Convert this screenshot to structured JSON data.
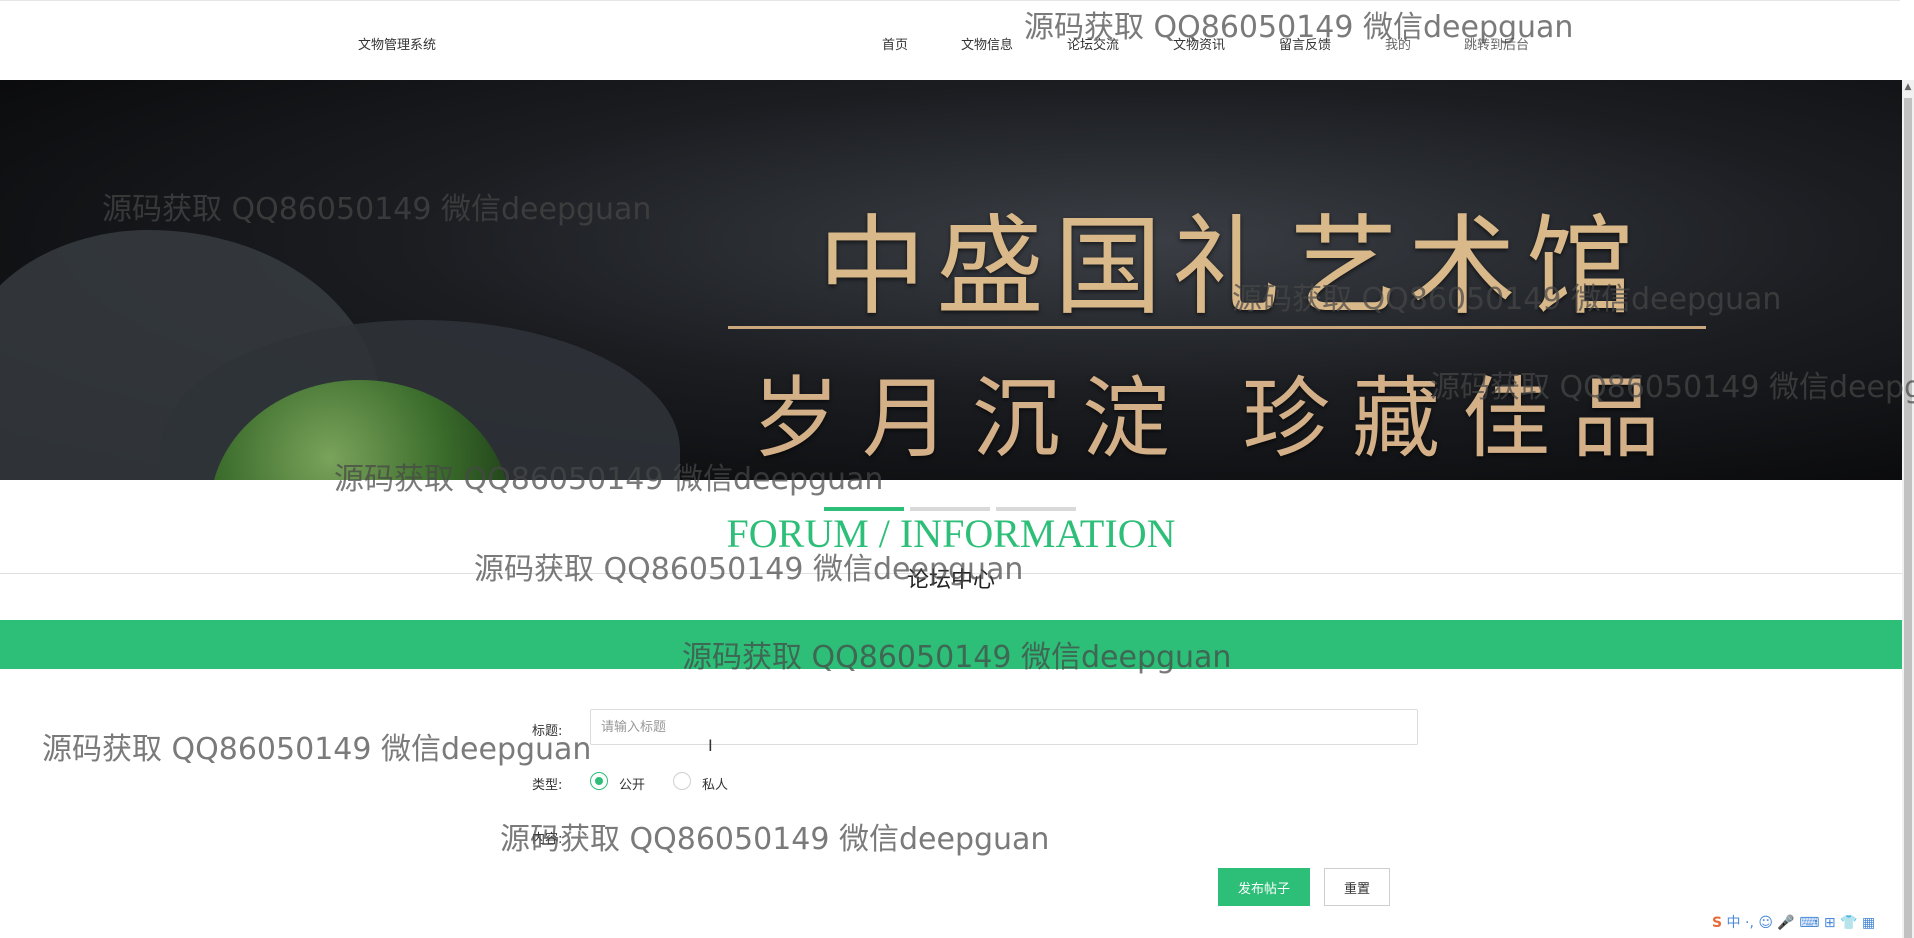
{
  "header": {
    "logo": "文物管理系统",
    "nav": [
      "首页",
      "文物信息",
      "论坛交流",
      "文物资讯",
      "留言反馈",
      "我的",
      "跳转到后台"
    ]
  },
  "banner": {
    "title": "中盛国礼艺术馆",
    "subtitle": "岁月沉淀  珍藏佳品",
    "slides": 3,
    "active_slide": 1
  },
  "section": {
    "title_en": "FORUM / INFORMATION",
    "title_zh": "论坛中心"
  },
  "form": {
    "title_label": "标题:",
    "title_placeholder": "请输入标题",
    "type_label": "类型:",
    "type_options": [
      "公开",
      "私人"
    ],
    "type_selected": "公开",
    "content_label": "内容:",
    "submit_label": "发布帖子",
    "reset_label": "重置"
  },
  "ime_toolbar": "中 ·, ☺ 🎤 ⌨ ⊞ 👕 ▦",
  "watermark": "源码获取 QQ86050149 微信deepguan",
  "colors": {
    "accent": "#2dbe78",
    "banner_text": "#d9b88a"
  }
}
